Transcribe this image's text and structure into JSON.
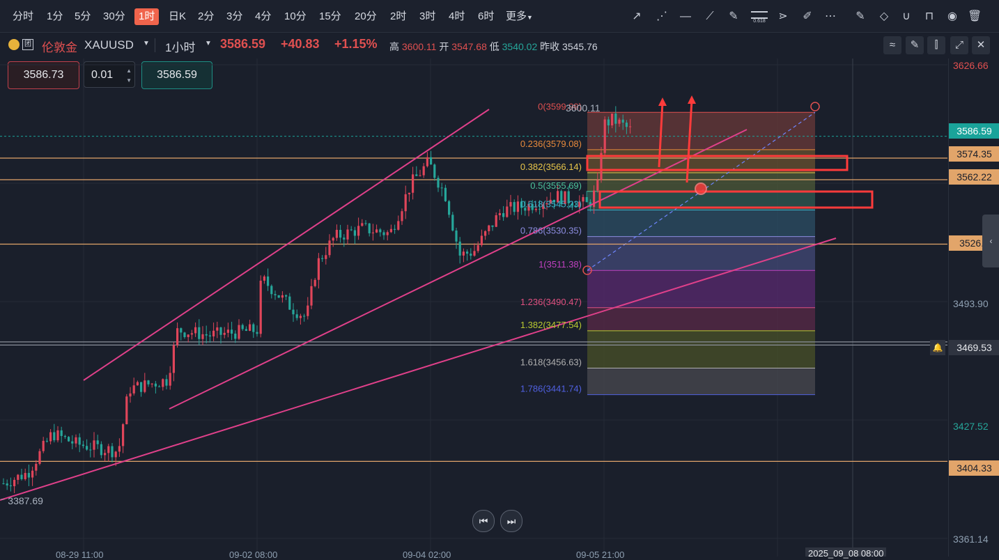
{
  "toolbar": {
    "timeframes": [
      "分时",
      "1分",
      "5分",
      "30分",
      "1时",
      "日K",
      "2分",
      "3分",
      "4分",
      "10分",
      "15分",
      "20分",
      "2时",
      "3时",
      "4时",
      "6时"
    ],
    "active_timeframe": "1时",
    "more_label": "更多",
    "tools": [
      "arrow-up-right-icon",
      "dotted-arrow-icon",
      "horizontal-line-icon",
      "trend-line-icon",
      "pen-icon",
      "fibonacci-icon",
      "gann-fan-icon",
      "highlighter-icon",
      "more-dots-icon",
      "edit-icon",
      "eraser-icon",
      "magnet-icon",
      "unlock-icon",
      "eye-icon",
      "trash-icon"
    ],
    "fib_icon_text": "0.618"
  },
  "quote": {
    "name": "伦敦金",
    "symbol": "XAUUSD",
    "period": "1小时",
    "price": "3586.59",
    "change": "+40.83",
    "change_pct": "+1.15%",
    "high_label": "高",
    "high": "3600.11",
    "open_label": "开",
    "open": "3547.68",
    "low_label": "低",
    "low": "3540.02",
    "prev_label": "昨收",
    "prev": "3545.76"
  },
  "order": {
    "sell_price": "3586.73",
    "lot": "0.01",
    "buy_price": "3586.59"
  },
  "price_axis": {
    "labels": [
      "3626.66",
      "3493.90",
      "3427.52",
      "3361.14"
    ],
    "tags": [
      {
        "value": "3586.59",
        "bg": "#1aa39a",
        "fg": "#ffffff"
      },
      {
        "value": "3574.35",
        "bg": "#e2a56a",
        "fg": "#1a1f2b"
      },
      {
        "value": "3562.22",
        "bg": "#e2a56a",
        "fg": "#1a1f2b"
      },
      {
        "value": "3526.1",
        "bg": "#e2a56a",
        "fg": "#1a1f2b"
      },
      {
        "value": "3469.53",
        "bg": "#2f3440",
        "fg": "#e6e8ec"
      },
      {
        "value": "3404.33",
        "bg": "#e2a56a",
        "fg": "#1a1f2b"
      }
    ]
  },
  "fib": {
    "levels": [
      {
        "label": "0(3599.99)",
        "color": "#e05050"
      },
      {
        "label": "0.236(3579.08)",
        "color": "#e88a3c"
      },
      {
        "label": "0.382(3566.14)",
        "color": "#e8c64a"
      },
      {
        "label": "0.5(3555.69)",
        "color": "#4cc29a"
      },
      {
        "label": "0.618(3545.23)",
        "color": "#3ab0c8"
      },
      {
        "label": "0.786(3530.35)",
        "color": "#8c8ce0"
      },
      {
        "label": "1(3511.38)",
        "color": "#c040c0"
      },
      {
        "label": "1.236(3490.47)",
        "color": "#e05080"
      },
      {
        "label": "1.382(3477.54)",
        "color": "#b8c830"
      },
      {
        "label": "1.618(3456.63)",
        "color": "#b0b0b0"
      },
      {
        "label": "1.786(3441.74)",
        "color": "#5060e0"
      }
    ]
  },
  "annotations": {
    "high_label": "3600.11",
    "low_label": "3387.69"
  },
  "time_axis": {
    "labels": [
      "08-29 11:00",
      "09-02 08:00",
      "09-04 02:00",
      "09-05 21:00"
    ],
    "cursor": "2025_09_08 08:00"
  },
  "colors": {
    "up": "#e0455a",
    "down": "#26a69a",
    "bg": "#1a1f2b"
  }
}
